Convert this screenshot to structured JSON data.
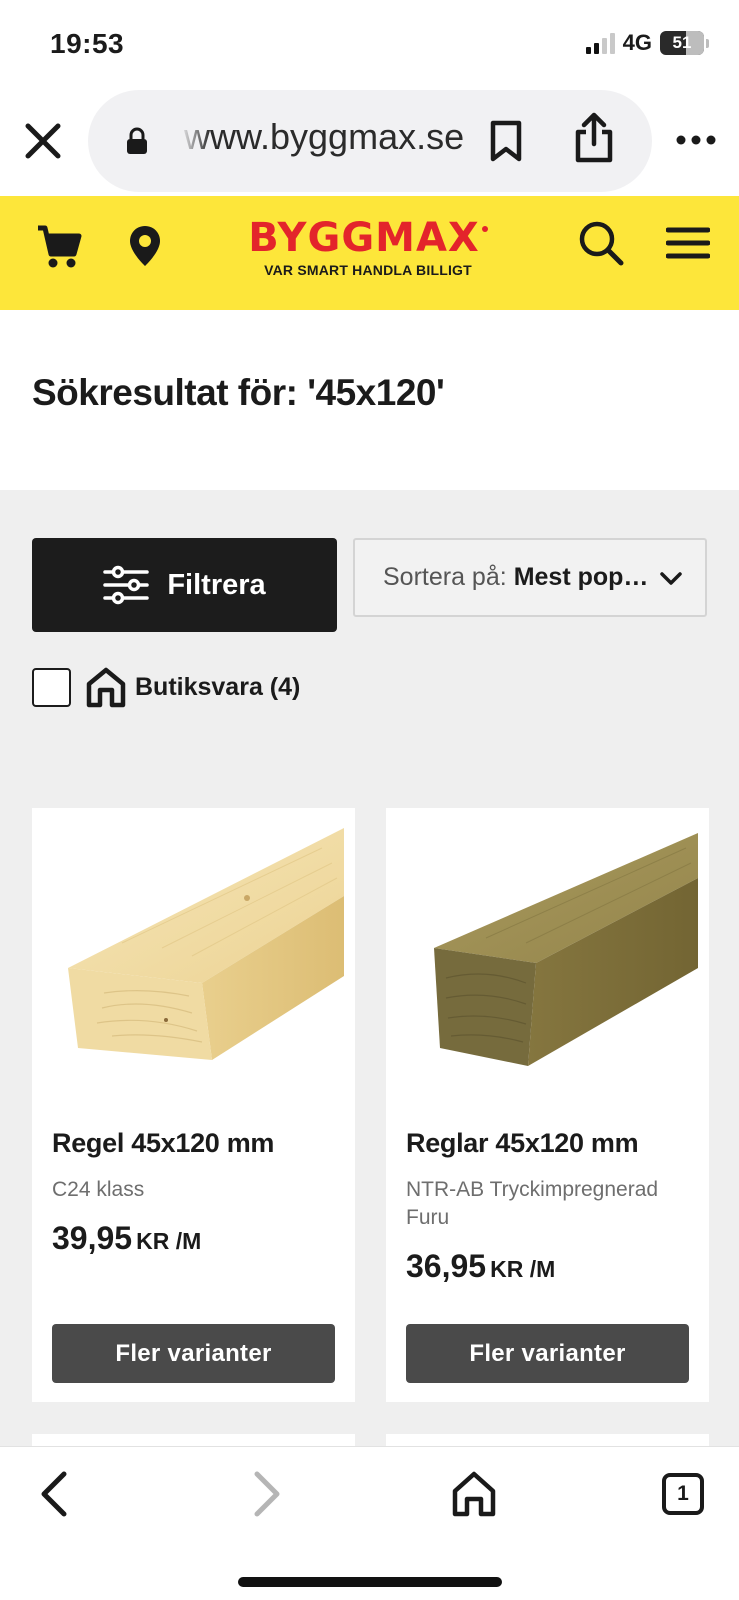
{
  "status_bar": {
    "time": "19:53",
    "network": "4G",
    "battery": "51"
  },
  "browser": {
    "url": "www.byggmax.se",
    "tab_count": "1"
  },
  "header": {
    "logo_text": "BYGGMAX",
    "tagline": "VAR SMART HANDLA BILLIGT",
    "background_color": "#fde63a",
    "logo_color": "#e3242b"
  },
  "search": {
    "title": "Sökresultat för: '45x120'"
  },
  "filters": {
    "filter_label": "Filtrera",
    "sort_label": "Sortera på:",
    "sort_value": "Mest populära",
    "store_goods_label": "Butiksvara (4)",
    "store_goods_checked": false
  },
  "products": [
    {
      "title": "Regel 45x120 mm",
      "subtitle": "C24 klass",
      "price": "39,95",
      "unit": "KR /M",
      "button_label": "Fler varianter",
      "image_icon": "light-wood-plank"
    },
    {
      "title": "Reglar 45x120 mm",
      "subtitle": "NTR-AB Tryckimpregnerad Furu",
      "price": "36,95",
      "unit": "KR /M",
      "button_label": "Fler varianter",
      "image_icon": "pressure-treated-wood-plank"
    }
  ]
}
